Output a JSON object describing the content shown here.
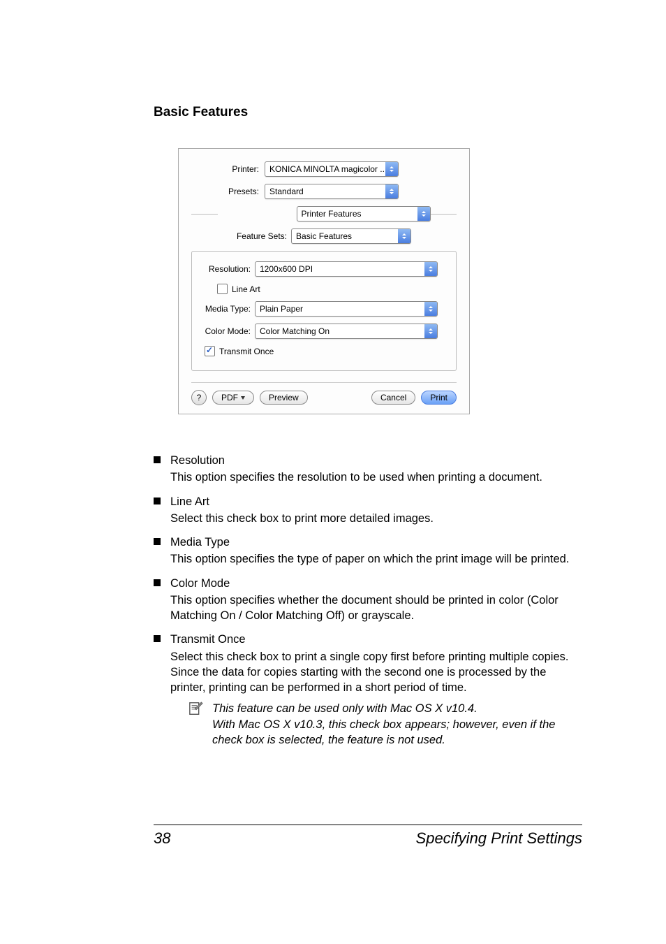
{
  "section_title": "Basic Features",
  "dialog": {
    "printer_label": "Printer:",
    "printer_value": "KONICA MINOLTA magicolor ...",
    "presets_label": "Presets:",
    "presets_value": "Standard",
    "pane_value": "Printer Features",
    "feature_sets_label": "Feature Sets:",
    "feature_sets_value": "Basic Features",
    "resolution_label": "Resolution:",
    "resolution_value": "1200x600 DPI",
    "line_art_label": "Line Art",
    "media_type_label": "Media Type:",
    "media_type_value": "Plain Paper",
    "color_mode_label": "Color Mode:",
    "color_mode_value": "Color Matching On",
    "transmit_once_label": "Transmit Once",
    "help": "?",
    "pdf": "PDF",
    "preview": "Preview",
    "cancel": "Cancel",
    "print": "Print"
  },
  "items": [
    {
      "title": "Resolution",
      "desc": "This option specifies the resolution to be used when printing a document."
    },
    {
      "title": "Line Art",
      "desc": "Select this check box to print more detailed images."
    },
    {
      "title": "Media Type",
      "desc": "This option specifies the type of paper on which the print image will be printed."
    },
    {
      "title": "Color Mode",
      "desc": "This option specifies whether the document should be printed in color (Color Matching On / Color Matching Off) or grayscale."
    },
    {
      "title": "Transmit Once",
      "desc": "Select this check box to print a single copy first before printing multiple copies. Since the data for copies starting with the second one is processed by the printer, printing can be performed in a short period of time."
    }
  ],
  "note": "This feature can be used only with Mac OS X v10.4.\nWith Mac OS X v10.3, this check box appears; however, even if the check box is selected, the feature is not used.",
  "footer": {
    "page": "38",
    "title": "Specifying Print Settings"
  }
}
